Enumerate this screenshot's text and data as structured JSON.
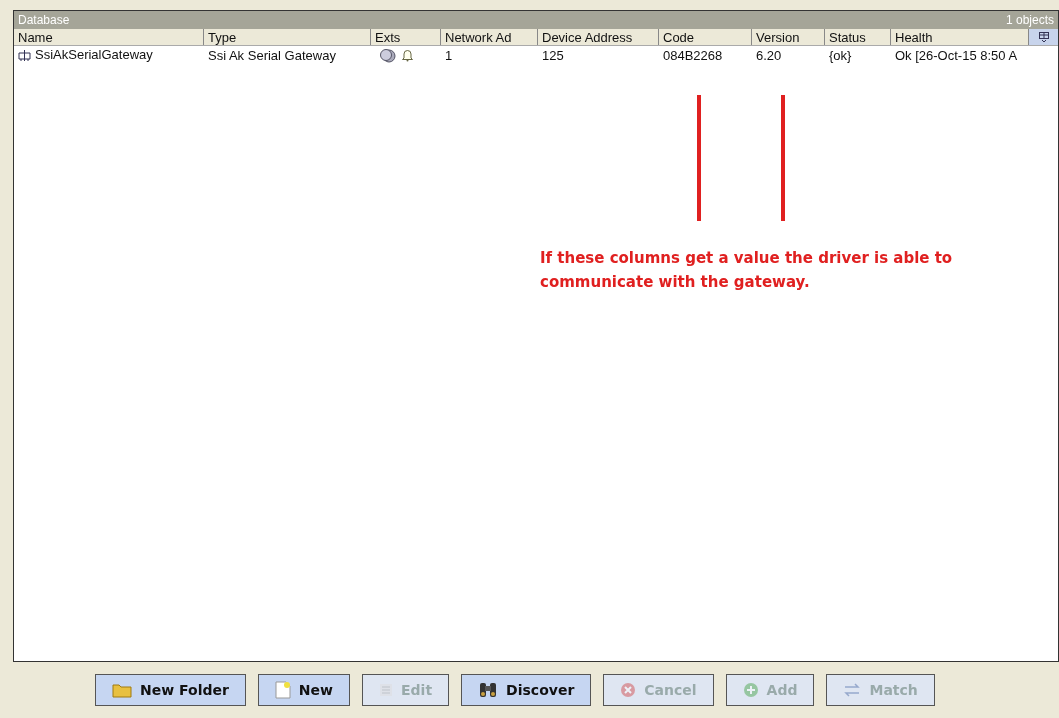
{
  "panel": {
    "title": "Database",
    "count": "1 objects"
  },
  "table": {
    "columns": [
      "Name",
      "Type",
      "Exts",
      "Network Ad",
      "Device Address",
      "Code",
      "Version",
      "Status",
      "Health"
    ],
    "rows": [
      {
        "name": "SsiAkSerialGateway",
        "type": "Ssi Ak Serial Gateway",
        "network_address": "1",
        "device_address": "125",
        "code": "084B2268",
        "version": "6.20",
        "status": "{ok}",
        "health": "Ok [26-Oct-15 8:50 A",
        "selected": false
      }
    ]
  },
  "annotation": {
    "text": "If these columns get a value the driver is able to communicate with the gateway."
  },
  "buttons": [
    {
      "label": "New Folder",
      "kind": "folder",
      "disabled": false
    },
    {
      "label": "New",
      "kind": "new",
      "disabled": false
    },
    {
      "label": "Edit",
      "kind": "edit",
      "disabled": true
    },
    {
      "label": "Discover",
      "kind": "discover",
      "disabled": false
    },
    {
      "label": "Cancel",
      "kind": "cancel",
      "disabled": true
    },
    {
      "label": "Add",
      "kind": "add",
      "disabled": true
    },
    {
      "label": "Match",
      "kind": "match",
      "disabled": true
    }
  ]
}
